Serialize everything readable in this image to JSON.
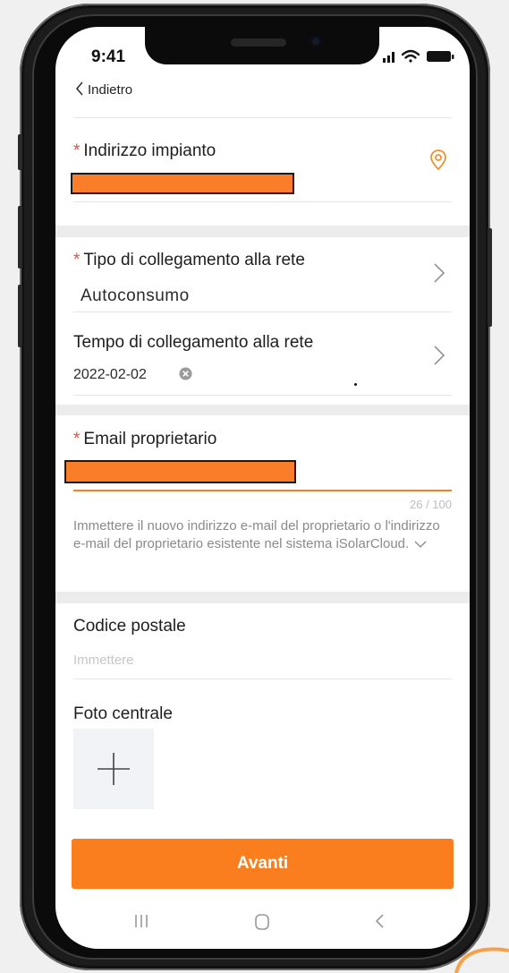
{
  "status_bar": {
    "time": "9:41"
  },
  "header": {
    "back_label": "Indietro"
  },
  "address": {
    "label": "Indirizzo impianto",
    "required_mark": "*"
  },
  "connection_type": {
    "label": "Tipo di collegamento alla rete",
    "required_mark": "*",
    "value": "Autoconsumo"
  },
  "connection_time": {
    "label": "Tempo di collegamento alla rete",
    "value": "2022-02-02"
  },
  "owner_email": {
    "label": "Email proprietario",
    "required_mark": "*",
    "counter": "26 / 100",
    "hint": "Immettere il nuovo indirizzo e-mail del proprietario o l'indirizzo e-mail del proprietario esistente nel sistema iSolarCloud."
  },
  "postal_code": {
    "label": "Codice postale",
    "placeholder": "Immettere"
  },
  "photo": {
    "label": "Foto centrale"
  },
  "footer": {
    "next_button": "Avanti"
  },
  "colors": {
    "accent": "#fa7e1e",
    "required": "#f04a3a",
    "redaction": "#fa7e2a"
  }
}
